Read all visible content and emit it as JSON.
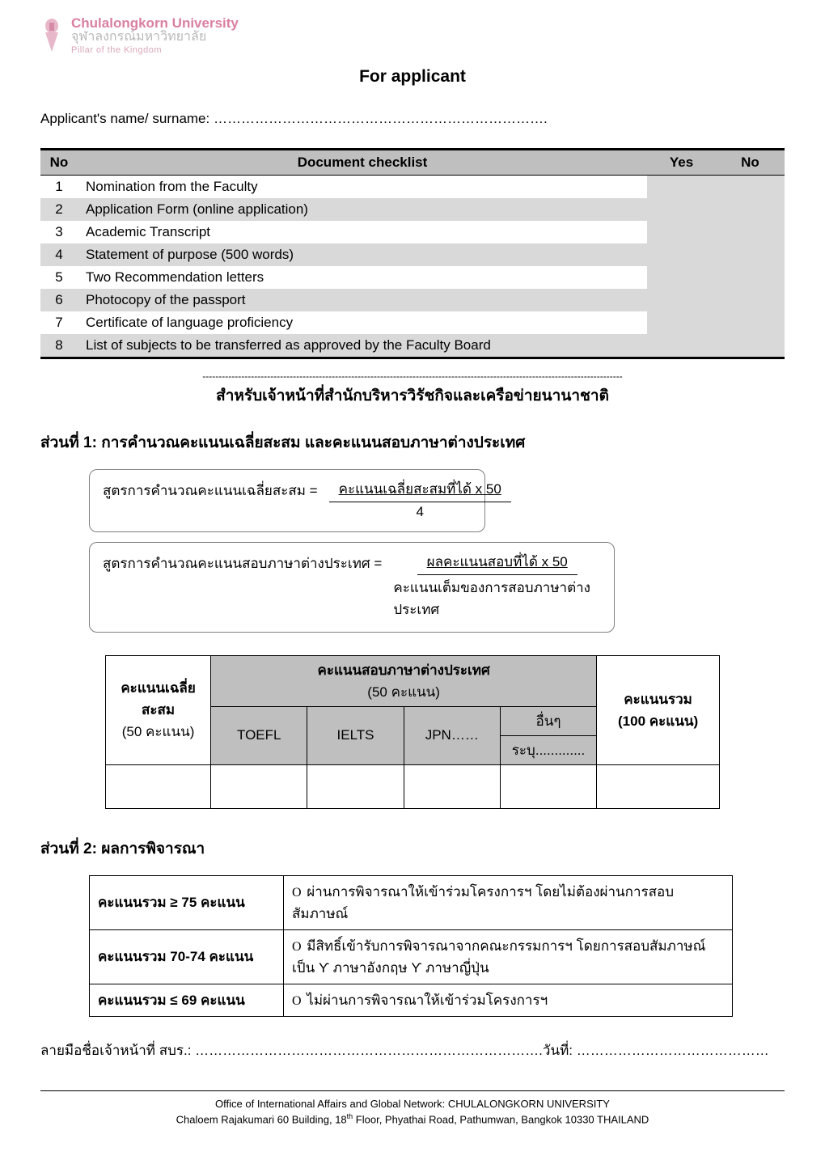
{
  "logo": {
    "line1": "Chulalongkorn University",
    "line2": "จุฬาลงกรณ์มหาวิทยาลัย",
    "line3": "Pillar of the Kingdom"
  },
  "title": "For applicant",
  "applicant_label": "Applicant's name/ surname: ……………………………………………………………….",
  "checklist": {
    "headers": {
      "no": "No",
      "doc": "Document checklist",
      "yes": "Yes",
      "nocol": "No"
    },
    "rows": [
      {
        "n": "1",
        "d": "Nomination from the Faculty"
      },
      {
        "n": "2",
        "d": "Application Form (online application)"
      },
      {
        "n": "3",
        "d": "Academic Transcript"
      },
      {
        "n": "4",
        "d": "Statement of purpose (500 words)"
      },
      {
        "n": "5",
        "d": "Two Recommendation letters"
      },
      {
        "n": "6",
        "d": "Photocopy of the passport"
      },
      {
        "n": "7",
        "d": "Certificate of language proficiency"
      },
      {
        "n": "8",
        "d": "List of subjects to be transferred as approved by the Faculty Board"
      }
    ]
  },
  "dashline": "----------------------------------------------------------------------------------------------------------------------------------",
  "officer_heading": "สำหรับเจ้าหน้าที่สำนักบริหารวิรัชกิจและเครือข่ายนานาชาติ",
  "section1_heading": "ส่วนที่ 1: การคำนวณคะแนนเฉลี่ยสะสม และคะแนนสอบภาษาต่างประเทศ",
  "formula1": {
    "lhs": "สูตรการคำนวณคะแนนเฉลี่ยสะสม  =",
    "num": "คะแนนเฉลี่ยสะสมที่ได้ x 50",
    "den": "4"
  },
  "formula2": {
    "lhs": "สูตรการคำนวณคะแนนสอบภาษาต่างประเทศ  =",
    "num": "ผลคะแนนสอบที่ได้ x 50",
    "den": "คะแนนเต็มของการสอบภาษาต่างประเทศ"
  },
  "score_table": {
    "gpa": {
      "line1": "คะแนนเฉลี่ย",
      "line2": "สะสม",
      "line3": "(50 คะแนน)"
    },
    "lang_header": "คะแนนสอบภาษาต่างประเทศ",
    "lang_sub": "(50 คะแนน)",
    "cols": {
      "toefl": "TOEFL",
      "ielts": "IELTS",
      "jpn": "JPN……",
      "other": "อื่นๆ",
      "other_sub": "ระบุ............."
    },
    "total": {
      "line1": "คะแนนรวม",
      "line2": "(100 คะแนน)"
    }
  },
  "section2_heading": "ส่วนที่ 2: ผลการพิจารณา",
  "results": {
    "r1": {
      "range": "คะแนนรวม ≥ 75 คะแนน",
      "text_a": "ผ่านการพิจารณาให้เข้าร่วมโครงการฯ โดยไม่ต้องผ่านการสอบ",
      "text_b": "สัมภาษณ์"
    },
    "r2": {
      "range": "คะแนนรวม 70-74 คะแนน",
      "text_a": "มีสิทธิ์เข้ารับการพิจารณาจากคณะกรรมการฯ โดยการสอบสัมภาษณ์",
      "text_b": "เป็น   ϒ ภาษาอังกฤษ   ϒ ภาษาญี่ปุ่น"
    },
    "r3": {
      "range": "คะแนนรวม ≤ 69 คะแนน",
      "text_a": "ไม่ผ่านการพิจารณาให้เข้าร่วมโครงการฯ"
    }
  },
  "circle_mark": "O",
  "sign": {
    "left": "ลายมือชื่อเจ้าหน้าที่ สบร.: ………………………………………………………………….",
    "right": "วันที่: ……………………………………"
  },
  "footer": {
    "line1": "Office of International Affairs and Global Network: CHULALONGKORN UNIVERSITY",
    "line2_a": "Chaloem Rajakumari 60 Building, 18",
    "line2_sup": "th",
    "line2_b": " Floor, Phyathai Road, Pathumwan, Bangkok 10330 THAILAND"
  }
}
